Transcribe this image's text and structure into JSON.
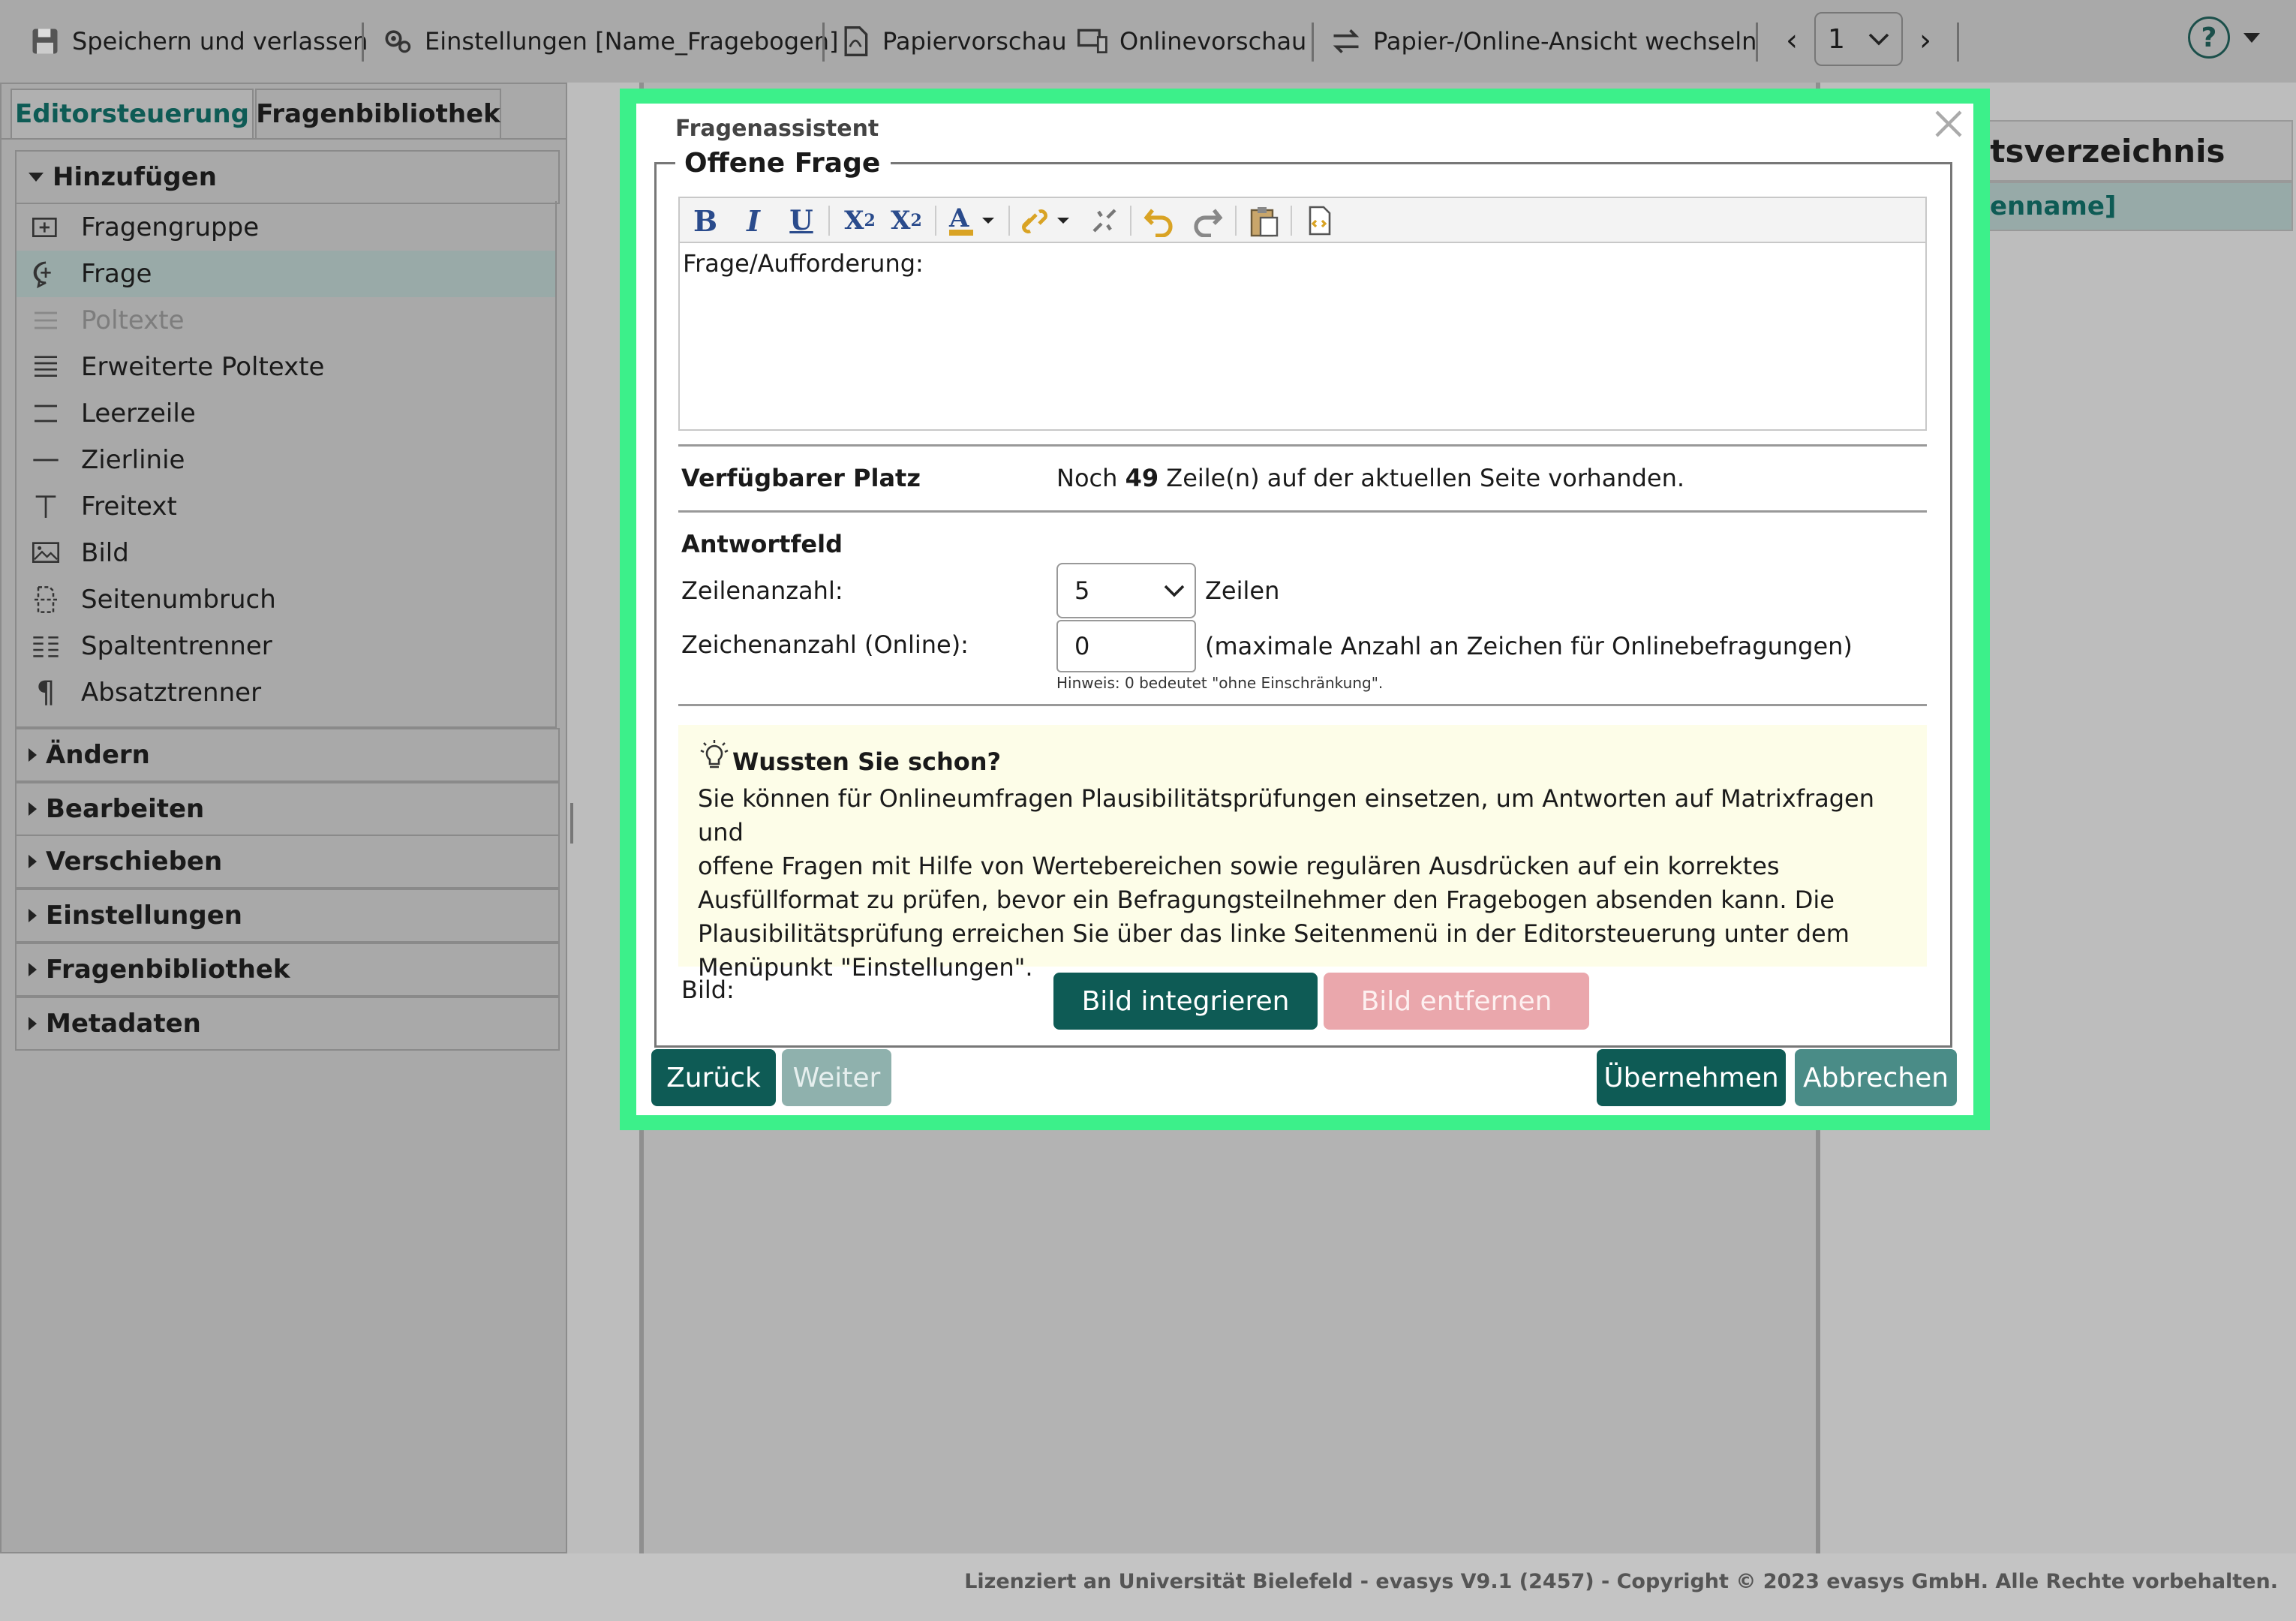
{
  "toolbar": {
    "save_exit": "Speichern und verlassen",
    "settings": "Einstellungen [Name_Fragebogen]",
    "paper_preview": "Papiervorschau",
    "online_preview": "Onlinevorschau",
    "switch_view": "Papier-/Online-Ansicht wechseln",
    "page_select": "1"
  },
  "left_panel": {
    "tabs": [
      "Editorsteuerung",
      "Fragenbibliothek"
    ],
    "add_section": "Hinzufügen",
    "add_items": [
      {
        "label": "Fragengruppe",
        "icon": "plus-box-icon"
      },
      {
        "label": "Frage",
        "icon": "speech-plus-icon"
      },
      {
        "label": "Poltexte",
        "icon": "lines-icon"
      },
      {
        "label": "Erweiterte Poltexte",
        "icon": "lines-extended-icon"
      },
      {
        "label": "Leerzeile",
        "icon": "empty-line-icon"
      },
      {
        "label": "Zierlinie",
        "icon": "line-icon"
      },
      {
        "label": "Freitext",
        "icon": "text-icon"
      },
      {
        "label": "Bild",
        "icon": "image-icon"
      },
      {
        "label": "Seitenumbruch",
        "icon": "page-break-icon"
      },
      {
        "label": "Spaltentrenner",
        "icon": "columns-icon"
      },
      {
        "label": "Absatztrenner",
        "icon": "pilcrow-icon"
      }
    ],
    "sections": [
      "Ändern",
      "Bearbeiten",
      "Verschieben",
      "Einstellungen",
      "Fragenbibliothek",
      "Metadaten"
    ]
  },
  "right_panel": {
    "title": "ltsverzeichnis",
    "item": "enname]"
  },
  "dialog": {
    "title": "Fragenassistent",
    "fieldset_legend": "Offene Frage",
    "editor_placeholder": "Frage/Aufforderung:",
    "available_label": "Verfügbarer Platz",
    "available_prefix": "Noch",
    "available_count": "49",
    "available_suffix": "Zeile(n) auf der aktuellen Seite vorhanden.",
    "answer_heading": "Antwortfeld",
    "rows_label": "Zeilenanzahl:",
    "rows_value": "5",
    "rows_unit": "Zeilen",
    "chars_label": "Zeichenanzahl (Online):",
    "chars_value": "0",
    "chars_desc": "(maximale Anzahl an Zeichen für Onlinebefragungen)",
    "chars_hint": "Hinweis: 0 bedeutet \"ohne Einschränkung\".",
    "tip_title": "Wussten Sie schon?",
    "tip_lines": [
      "Sie können für Onlineumfragen Plausibilitätsprüfungen einsetzen, um Antworten auf Matrixfragen und",
      "offene Fragen mit Hilfe von Wertebereichen sowie regulären Ausdrücken auf ein korrektes",
      "Ausfüllformat zu prüfen, bevor ein Befragungsteilnehmer den Fragebogen absenden kann. Die",
      "Plausibilitätsprüfung erreichen Sie über das linke Seitenmenü in der Editorsteuerung unter dem",
      "Menüpunkt \"Einstellungen\"."
    ],
    "image_label": "Bild:",
    "btn_integrate": "Bild integrieren",
    "btn_remove": "Bild entfernen",
    "btn_back": "Zurück",
    "btn_next": "Weiter",
    "btn_apply": "Übernehmen",
    "btn_cancel": "Abbrechen"
  },
  "footer": {
    "license": "Lizenziert an Universität Bielefeld - evasys V9.1 (2457) - Copyright © 2023 evasys GmbH. Alle Rechte vorbehalten."
  },
  "colors": {
    "teal": "#0e5b55",
    "teal_light": "#4a8c87",
    "pink": "#eaa7ac",
    "highlight": "#3cf08a",
    "tip_bg": "#fdfde8"
  }
}
